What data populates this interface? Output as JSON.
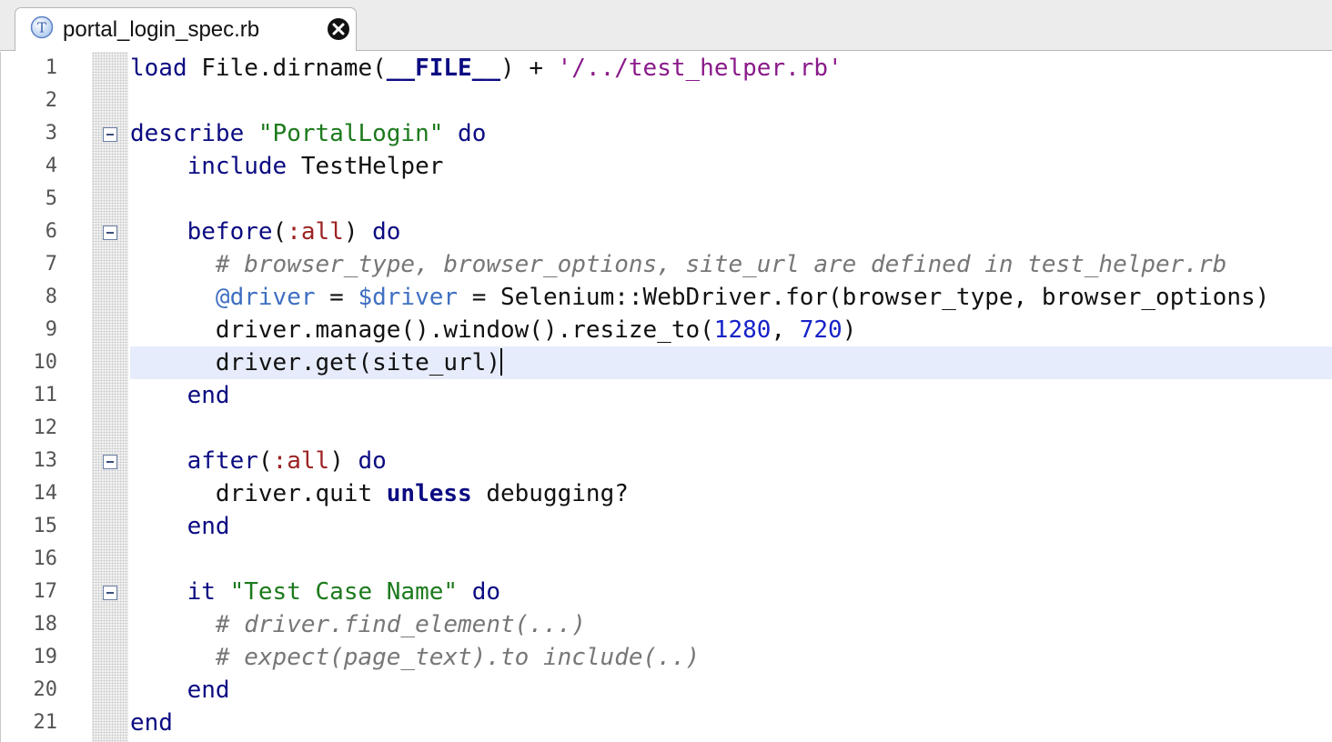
{
  "tab": {
    "label": "portal_login_spec.rb",
    "icon": "ruby-test-file-icon",
    "icon_letter": "T",
    "close_icon": "close-icon"
  },
  "editor": {
    "current_line": 10,
    "colors": {
      "keyword": "#0b0b82",
      "string": "#1c7a1c",
      "single_quote_string": "#8a1a8a",
      "symbol": "#9c2323",
      "number": "#1622c8",
      "variable": "#3f6fc2",
      "comment": "#777777",
      "current_line_bg": "#e6ecfb"
    },
    "lines": [
      {
        "num": "1"
      },
      {
        "num": "2"
      },
      {
        "num": "3"
      },
      {
        "num": "4"
      },
      {
        "num": "5"
      },
      {
        "num": "6"
      },
      {
        "num": "7"
      },
      {
        "num": "8"
      },
      {
        "num": "9"
      },
      {
        "num": "10"
      },
      {
        "num": "11"
      },
      {
        "num": "12"
      },
      {
        "num": "13"
      },
      {
        "num": "14"
      },
      {
        "num": "15"
      },
      {
        "num": "16"
      },
      {
        "num": "17"
      },
      {
        "num": "18"
      },
      {
        "num": "19"
      },
      {
        "num": "20"
      },
      {
        "num": "21"
      }
    ],
    "code": {
      "l1": {
        "kw": "load",
        "rest": " File.dirname(",
        "file": "__FILE__",
        "rest2": ") + ",
        "str": "'/../test_helper.rb'"
      },
      "l3": {
        "kw": "describe",
        "sp": " ",
        "str": "\"PortalLogin\"",
        "sp2": " ",
        "do": "do"
      },
      "l4": {
        "indent": "    ",
        "kw": "include",
        "rest": " TestHelper"
      },
      "l6": {
        "indent": "    ",
        "kw": "before",
        "p1": "(",
        "sym": ":all",
        "p2": ") ",
        "do": "do"
      },
      "l7": {
        "indent": "      ",
        "comment": "# browser_type, browser_options, site_url are defined in test_helper.rb"
      },
      "l8": {
        "indent": "      ",
        "ivar": "@driver",
        "eq": " = ",
        "gvar": "$driver",
        "rest": " = Selenium::WebDriver.for(browser_type, browser_options)"
      },
      "l9": {
        "indent": "      ",
        "rest": "driver.manage().window().resize_to(",
        "n1": "1280",
        "sep": ", ",
        "n2": "720",
        "close": ")"
      },
      "l10": {
        "indent": "      ",
        "rest": "driver.get(site_url)"
      },
      "l11": {
        "indent": "    ",
        "kw": "end"
      },
      "l13": {
        "indent": "    ",
        "kw": "after",
        "p1": "(",
        "sym": ":all",
        "p2": ") ",
        "do": "do"
      },
      "l14": {
        "indent": "      ",
        "rest": "driver.quit ",
        "kw": "unless",
        "rest2": " debugging?"
      },
      "l15": {
        "indent": "    ",
        "kw": "end"
      },
      "l17": {
        "indent": "    ",
        "kw": "it",
        "sp": " ",
        "str": "\"Test Case Name\"",
        "sp2": " ",
        "do": "do"
      },
      "l18": {
        "indent": "      ",
        "comment": "# driver.find_element(...)"
      },
      "l19": {
        "indent": "      ",
        "comment": "# expect(page_text).to include(..)"
      },
      "l20": {
        "indent": "    ",
        "kw": "end"
      },
      "l21": {
        "kw": "end"
      }
    },
    "fold_icon": "fold-collapse-icon"
  }
}
